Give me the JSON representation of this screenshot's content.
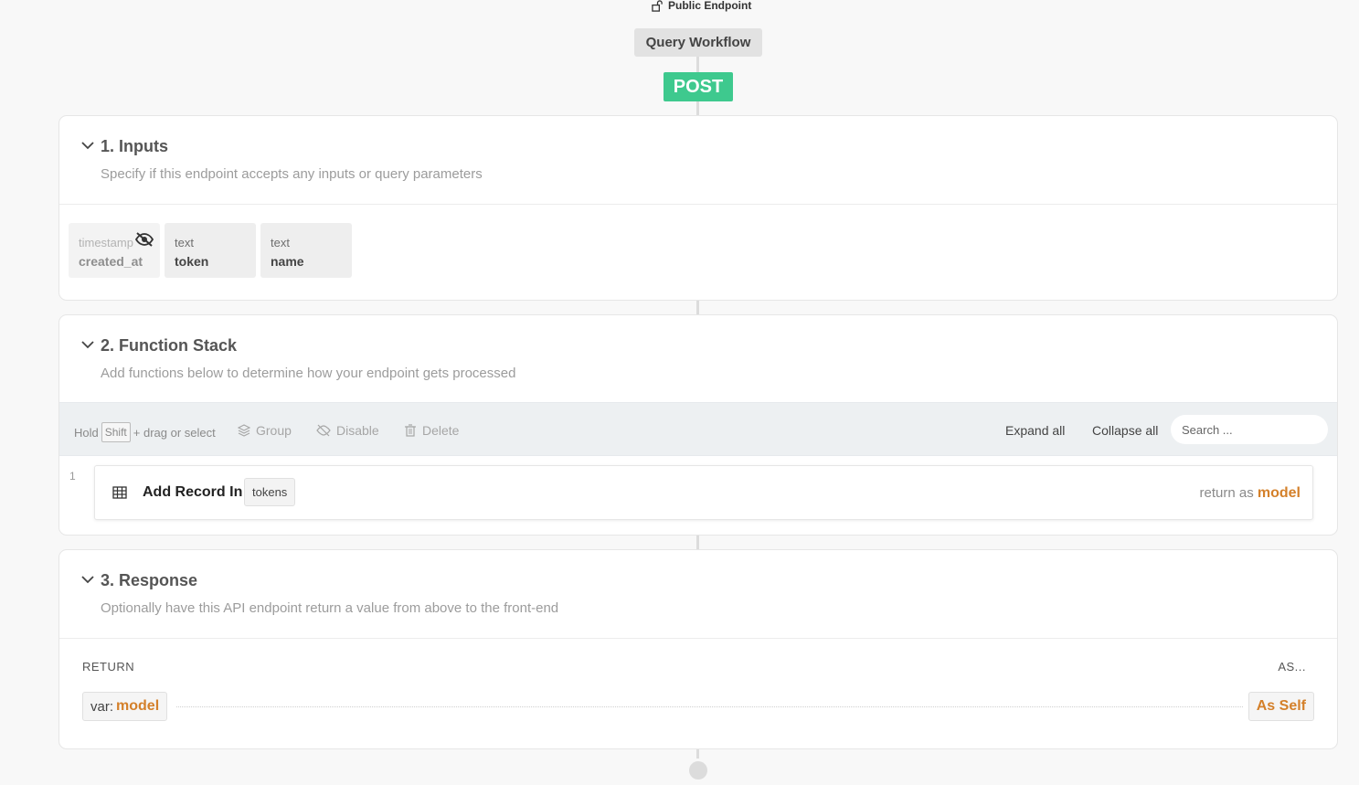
{
  "header": {
    "access_label": "Public Endpoint",
    "workflow_name": "Query Workflow",
    "method": "POST"
  },
  "inputs": {
    "title": "1. Inputs",
    "subtitle": "Specify if this endpoint accepts any inputs or query parameters",
    "fields": [
      {
        "type": "timestamp",
        "name": "created_at",
        "hidden": true
      },
      {
        "type": "text",
        "name": "token",
        "hidden": false
      },
      {
        "type": "text",
        "name": "name",
        "hidden": false
      }
    ]
  },
  "function_stack": {
    "title": "2. Function Stack",
    "subtitle": "Add functions below to determine how your endpoint gets processed",
    "toolbar": {
      "hint_prefix": "Hold",
      "hint_key": "Shift",
      "hint_suffix": "+ drag or select",
      "group_label": "Group",
      "disable_label": "Disable",
      "delete_label": "Delete",
      "expand_label": "Expand all",
      "collapse_label": "Collapse all",
      "search_placeholder": "Search ..."
    },
    "steps": [
      {
        "number": "1",
        "label": "Add Record In",
        "table": "tokens",
        "return_prefix": "return as",
        "return_var": "model"
      }
    ]
  },
  "response": {
    "title": "3. Response",
    "subtitle": "Optionally have this API endpoint return a value from above to the front-end",
    "return_header": "RETURN",
    "as_header": "AS...",
    "var_prefix": "var:",
    "var_name": "model",
    "as_value": "As Self"
  },
  "colors": {
    "method_badge": "#3ec98e",
    "variable": "#d4802a",
    "spine": "#dcdcdc"
  }
}
